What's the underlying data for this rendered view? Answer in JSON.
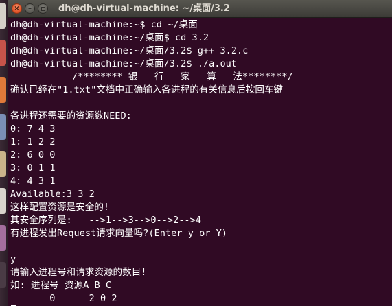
{
  "window": {
    "title": "dh@dh-virtual-machine: ~/桌面/3.2",
    "close_glyph": "×",
    "minimize_glyph": "–"
  },
  "launcher": {
    "item_colors": [
      "#d4d0c8",
      "#c7534a",
      "#e07a3a",
      "#7a8fb5",
      "#c9b48a",
      "#d9d4cc",
      "#a46e9e",
      "#4a3b45"
    ]
  },
  "terminal": {
    "background_color": "#300a24",
    "text_color": "#ffffff",
    "lines": [
      "dh@dh-virtual-machine:~$ cd ~/桌面",
      "dh@dh-virtual-machine:~/桌面$ cd 3.2",
      "dh@dh-virtual-machine:~/桌面/3.2$ g++ 3.2.c",
      "dh@dh-virtual-machine:~/桌面/3.2$ ./a.out",
      "           /******** 银   行   家   算   法********/",
      "确认已经在\"1.txt\"文档中正确输入各进程的有关信息后按回车键",
      "",
      "各进程还需要的资源数NEED:",
      "0: 7 4 3",
      "1: 1 2 2",
      "2: 6 0 0",
      "3: 0 1 1",
      "4: 4 3 1",
      "Available:3 3 2",
      "这样配置资源是安全的!",
      "其安全序列是:   -->1-->3-->0-->2-->4",
      "有进程发出Request请求向量吗?(Enter y or Y)",
      "",
      "y",
      "请输入进程号和请求资源的数目!",
      "如: 进程号 资源A B C",
      "       0      2 0 2"
    ]
  }
}
